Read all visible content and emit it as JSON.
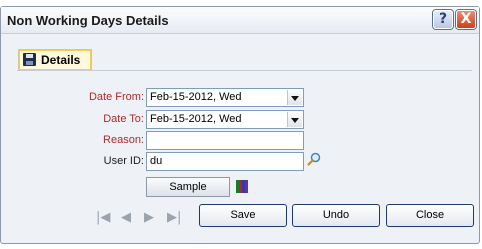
{
  "window": {
    "title": "Non Working Days Details",
    "help_glyph": "?",
    "close_glyph": "X"
  },
  "tabs": [
    {
      "label": "Details",
      "icon": "floppy-disk-icon",
      "selected": true
    }
  ],
  "form": {
    "date_from": {
      "label": "Date From:",
      "value": "Feb-15-2012, Wed",
      "required": true
    },
    "date_to": {
      "label": "Date To:",
      "value": "Feb-15-2012, Wed",
      "required": true
    },
    "reason": {
      "label": "Reason:",
      "value": "",
      "required": true
    },
    "user_id": {
      "label": "User ID:",
      "value": "du",
      "required": false
    }
  },
  "sample": {
    "label": "Sample",
    "icon": "color-bars-icon"
  },
  "navigation": {
    "first": "first-record-icon",
    "prev": "previous-record-icon",
    "next": "next-record-icon",
    "last": "last-record-icon"
  },
  "buttons": {
    "save": "Save",
    "undo": "Undo",
    "close": "Close"
  },
  "colors": {
    "required_label": "#b02a2a",
    "tab_highlight": "#f2ce56",
    "button_border": "#1f3a6a"
  }
}
